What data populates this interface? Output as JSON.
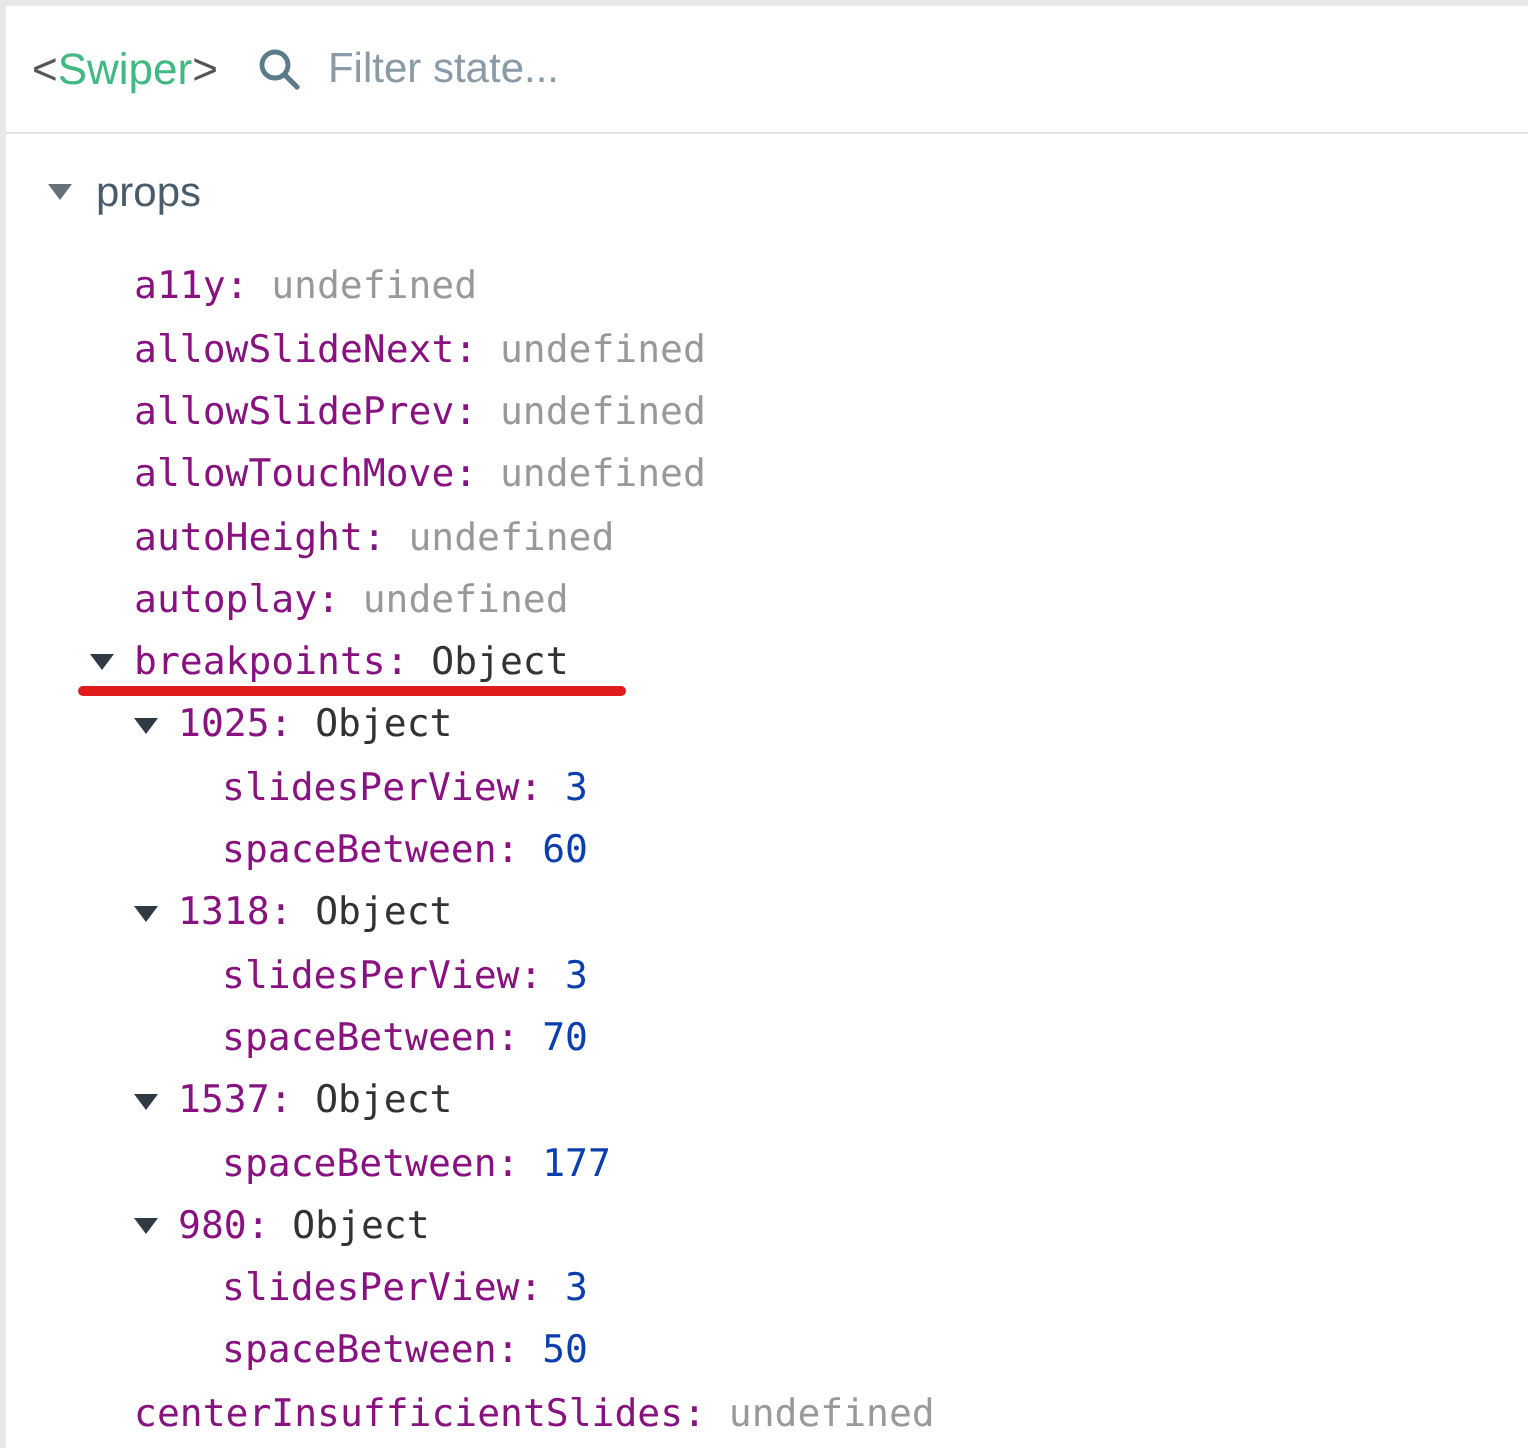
{
  "header": {
    "component": {
      "open": "<",
      "name": "Swiper",
      "close": ">"
    },
    "filter": {
      "placeholder": "Filter state..."
    }
  },
  "section": {
    "title": "props",
    "expanded": true,
    "items": [
      {
        "key": "a11y:",
        "value": "undefined",
        "kind": "undefined"
      },
      {
        "key": "allowSlideNext:",
        "value": "undefined",
        "kind": "undefined"
      },
      {
        "key": "allowSlidePrev:",
        "value": "undefined",
        "kind": "undefined"
      },
      {
        "key": "allowTouchMove:",
        "value": "undefined",
        "kind": "undefined"
      },
      {
        "key": "autoHeight:",
        "value": "undefined",
        "kind": "undefined"
      },
      {
        "key": "autoplay:",
        "value": "undefined",
        "kind": "undefined"
      },
      {
        "key": "breakpoints:",
        "value": "Object",
        "kind": "object",
        "expanded": true,
        "underlined": true,
        "children": [
          {
            "key": "1025:",
            "value": "Object",
            "kind": "object",
            "expanded": true,
            "children": [
              {
                "key": "slidesPerView:",
                "value": "3",
                "kind": "number"
              },
              {
                "key": "spaceBetween:",
                "value": "60",
                "kind": "number"
              }
            ]
          },
          {
            "key": "1318:",
            "value": "Object",
            "kind": "object",
            "expanded": true,
            "children": [
              {
                "key": "slidesPerView:",
                "value": "3",
                "kind": "number"
              },
              {
                "key": "spaceBetween:",
                "value": "70",
                "kind": "number"
              }
            ]
          },
          {
            "key": "1537:",
            "value": "Object",
            "kind": "object",
            "expanded": true,
            "children": [
              {
                "key": "spaceBetween:",
                "value": "177",
                "kind": "number"
              }
            ]
          },
          {
            "key": "980:",
            "value": "Object",
            "kind": "object",
            "expanded": true,
            "children": [
              {
                "key": "slidesPerView:",
                "value": "3",
                "kind": "number"
              },
              {
                "key": "spaceBetween:",
                "value": "50",
                "kind": "number"
              }
            ]
          }
        ]
      },
      {
        "key": "centerInsufficientSlides:",
        "value": "undefined",
        "kind": "undefined"
      }
    ]
  }
}
